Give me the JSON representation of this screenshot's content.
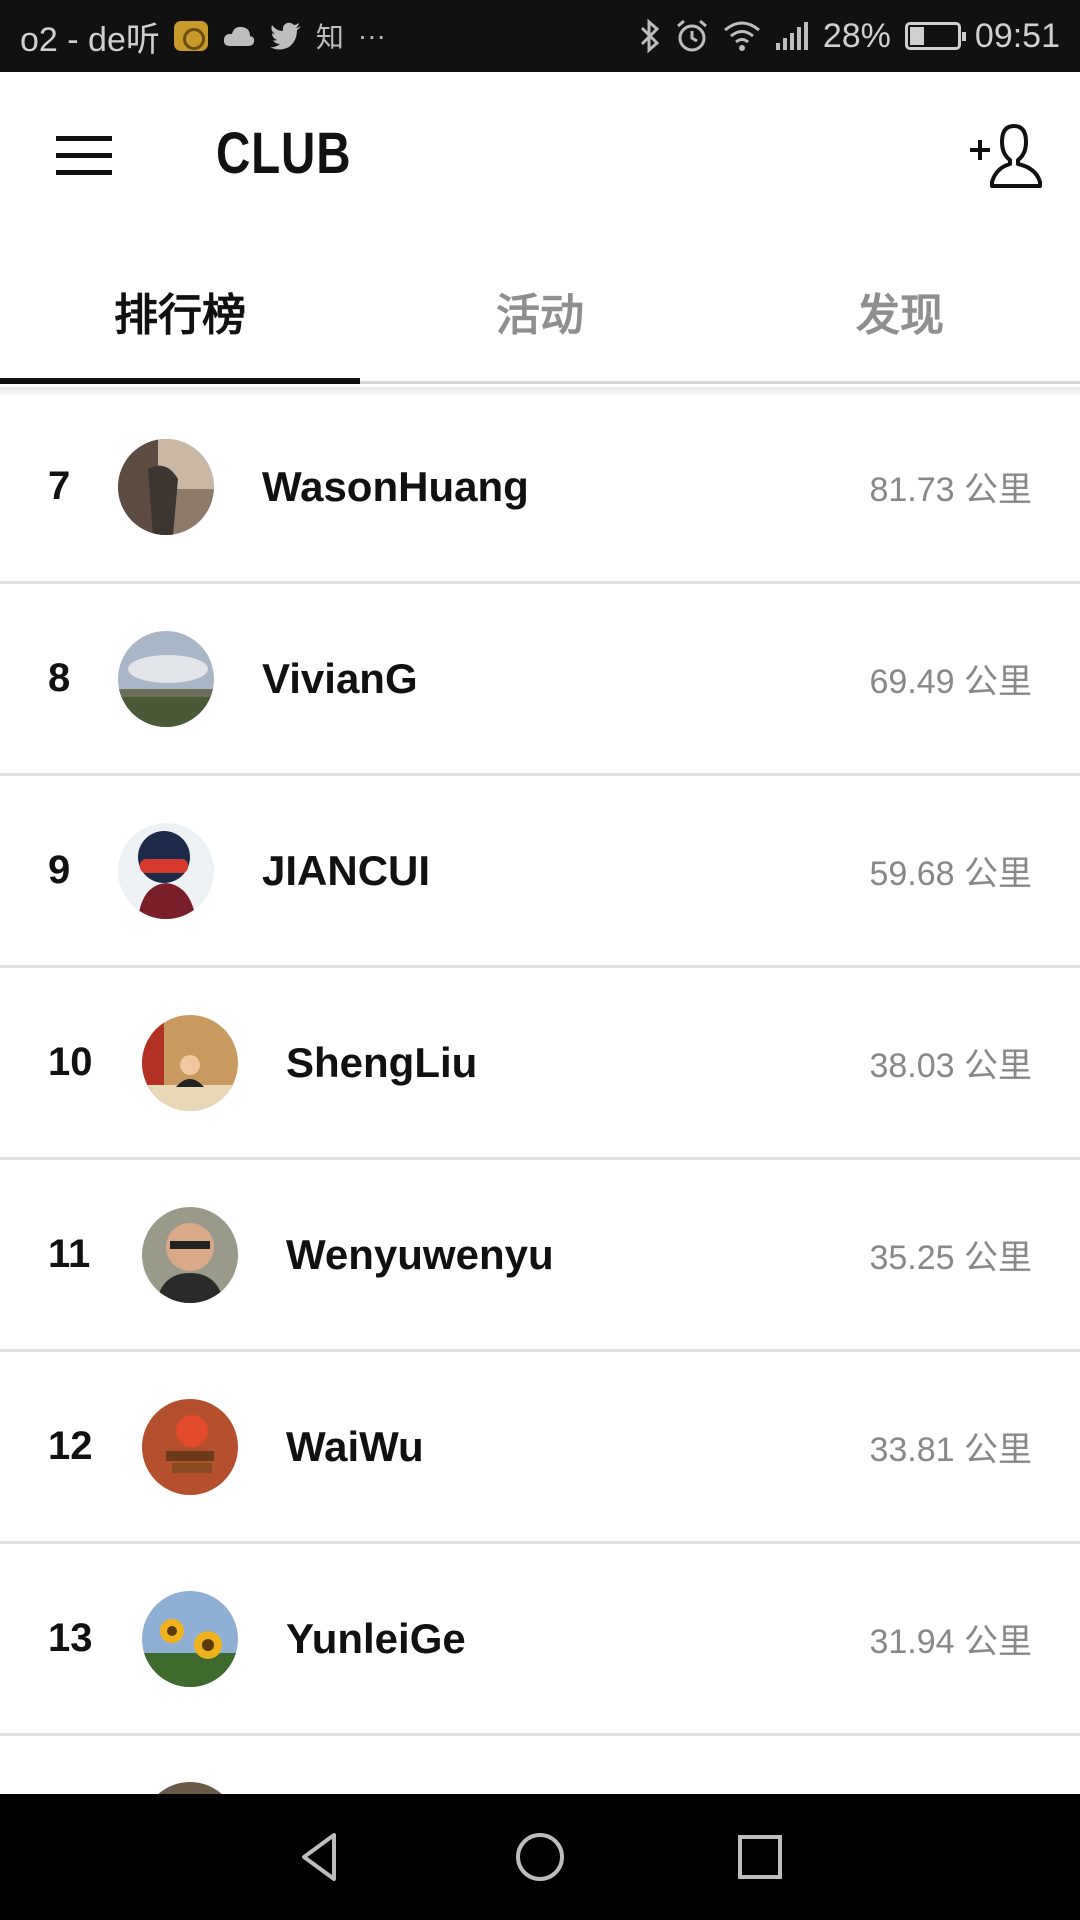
{
  "status_bar": {
    "left_text": "o2 - de听",
    "zhihu": "知",
    "more": "···",
    "battery": "28%",
    "time": "09:51"
  },
  "app_bar": {
    "title": "CLUB",
    "menu_icon": "menu-icon",
    "add_icon": "add-user-icon"
  },
  "tabs": [
    {
      "label": "排行榜",
      "active": true
    },
    {
      "label": "活动",
      "active": false
    },
    {
      "label": "发现",
      "active": false
    }
  ],
  "leaderboard": [
    {
      "rank": "7",
      "name": "WasonHuang",
      "distance": "81.73 公里"
    },
    {
      "rank": "8",
      "name": "VivianG",
      "distance": "69.49 公里"
    },
    {
      "rank": "9",
      "name": "JIANCUI",
      "distance": "59.68 公里"
    },
    {
      "rank": "10",
      "name": "ShengLiu",
      "distance": "38.03 公里"
    },
    {
      "rank": "11",
      "name": "Wenyuwenyu",
      "distance": "35.25 公里"
    },
    {
      "rank": "12",
      "name": "WaiWu",
      "distance": "33.81 公里"
    },
    {
      "rank": "13",
      "name": "YunleiGe",
      "distance": "31.94 公里"
    }
  ],
  "nav_bar": {
    "back_icon": "back-icon",
    "home_icon": "home-icon",
    "recents_icon": "recents-icon"
  },
  "colors": {
    "status_bar_bg": "#111111",
    "active_tab": "#111111",
    "inactive_tab": "#8f8f8f",
    "distance_text": "#888888"
  }
}
